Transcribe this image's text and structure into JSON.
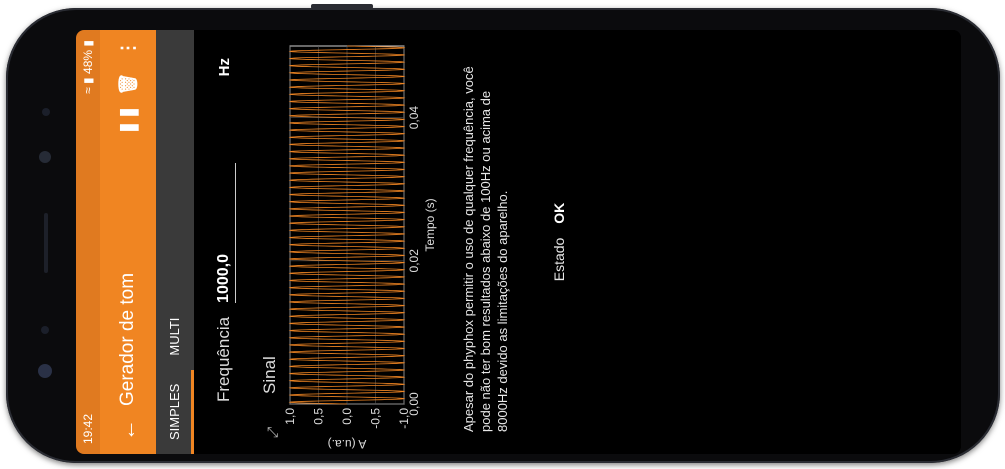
{
  "status_bar": {
    "time": "19:42",
    "battery": "48%"
  },
  "app_bar": {
    "title": "Gerador de tom",
    "back_icon": "arrow-back-icon",
    "pause_icon": "pause-icon",
    "delete_icon": "trash-icon",
    "menu_icon": "more-vert-icon"
  },
  "tabs": [
    {
      "label": "SIMPLES",
      "active": true
    },
    {
      "label": "MULTI",
      "active": false
    }
  ],
  "frequency": {
    "label": "Frequência",
    "value": "1000,0",
    "unit": "Hz"
  },
  "chart_data": {
    "type": "line",
    "title": "Sinal",
    "xlabel": "Tempo (s)",
    "ylabel": "A (u.a.)",
    "xlim": [
      0,
      0.05
    ],
    "ylim": [
      -1,
      1
    ],
    "x_ticks": [
      "0,00",
      "0,02",
      "0,04"
    ],
    "y_ticks": [
      "1,0",
      "0,5",
      "0,0",
      "-0,5",
      "-1,0"
    ],
    "series": [
      {
        "frequency_hz": 1000,
        "amplitude": 1,
        "color": "#f08522"
      }
    ],
    "grid": true
  },
  "note": "Apesar do phyphox permitir o uso de qualquer frequência, você pode não ter bom resultados abaixo de 100Hz ou acima de 8000Hz devido as limitações do aparelho.",
  "state": {
    "label": "Estado",
    "value": "OK"
  },
  "colors": {
    "accent": "#f08522",
    "status_bar": "#e07a20",
    "tab_bar": "#3a3a3a"
  }
}
